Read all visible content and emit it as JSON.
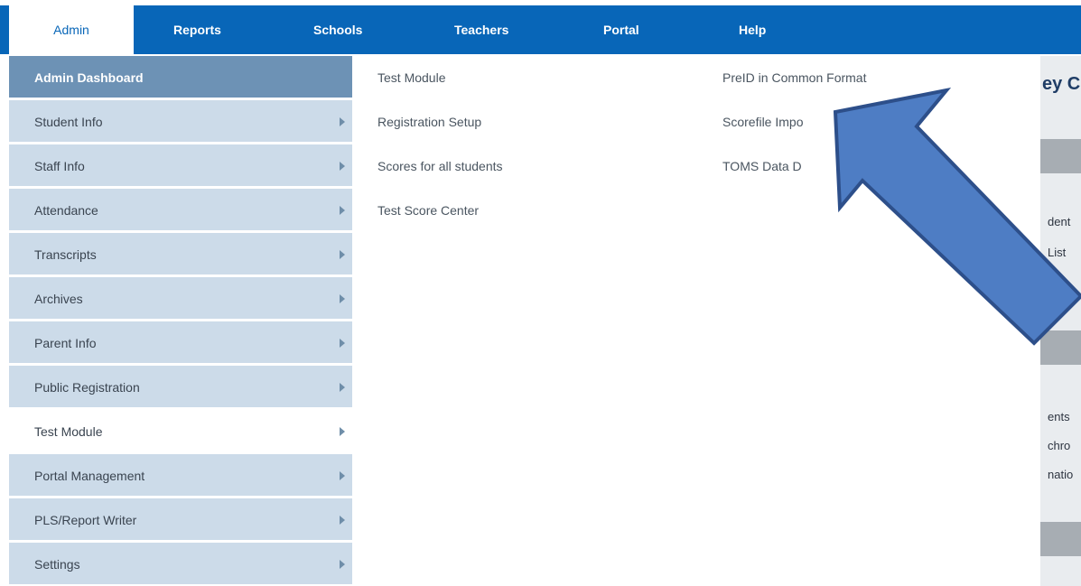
{
  "nav": {
    "tabs": [
      "Admin",
      "Reports",
      "Schools",
      "Teachers",
      "Portal",
      "Help"
    ],
    "active": "Admin",
    "color": "#0866b8"
  },
  "leftmenu": {
    "header": "Admin Dashboard",
    "items": [
      "Student Info",
      "Staff Info",
      "Attendance",
      "Transcripts",
      "Archives",
      "Parent Info",
      "Public Registration",
      "Test Module",
      "Portal Management",
      "PLS/Report Writer",
      "Settings"
    ],
    "selected": "Test Module"
  },
  "submenu": {
    "col1": [
      "Test Module",
      "Registration Setup",
      "Scores for all students",
      "Test Score Center"
    ],
    "col2": [
      "PreID in Common Format",
      "Scorefile Impo",
      "TOMS Data D"
    ]
  },
  "background": {
    "title": "ey C",
    "texts": [
      "dent",
      "List",
      "ents",
      "chro",
      "natio"
    ]
  },
  "annotation": {
    "arrow_color": "#4e7dc4",
    "arrow_border": "#2d4f8a"
  }
}
